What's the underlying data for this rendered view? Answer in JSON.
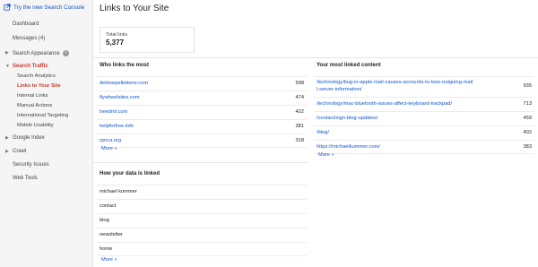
{
  "sidebar": {
    "try_new": "Try the new Search Console",
    "items": {
      "dashboard": "Dashboard",
      "messages": "Messages (4)",
      "search_appearance": "Search Appearance",
      "search_traffic": "Search Traffic",
      "search_analytics": "Search Analytics",
      "links_to_your_site": "Links to Your Site",
      "internal_links": "Internal Links",
      "manual_actions": "Manual Actions",
      "international_targeting": "International Targeting",
      "mobile_usability": "Mobile Usability",
      "google_index": "Google Index",
      "crawl": "Crawl",
      "security_issues": "Security Issues",
      "web_tools": "Web Tools"
    },
    "info_badge": "i"
  },
  "main": {
    "title": "Links to Your Site",
    "total": {
      "label": "Total links",
      "value": "5,377"
    },
    "who_links": {
      "title": "Who links the most",
      "rows": [
        {
          "domain": "delmarpelletierie.com",
          "count": "598"
        },
        {
          "domain": "flywheelsites.com",
          "count": "474"
        },
        {
          "domain": "treedml.com",
          "count": "422"
        },
        {
          "domain": "helpforfree.info",
          "count": "381"
        },
        {
          "domain": "rpnca.org",
          "count": "318"
        }
      ],
      "more": "More »"
    },
    "most_linked": {
      "title": "Your most linked content",
      "rows": [
        {
          "url": "/technology/bug-in-apple-mail-causes-accounts-to-lose-outgoing-mail",
          "url2": "l-server-information/",
          "count": "935"
        },
        {
          "url": "/technology/mac-bluetooth-issues-affect-keyboard-trackpad/",
          "url2": "",
          "count": "713"
        },
        {
          "url": "/contact/sign-blog-updates/",
          "url2": "",
          "count": "459"
        },
        {
          "url": "/blog/",
          "url2": "",
          "count": "402"
        },
        {
          "url": "https://michaelkummer.com/",
          "url2": "",
          "count": "383"
        }
      ],
      "more": "More »"
    },
    "how_linked": {
      "title": "How your data is linked",
      "rows": [
        "michael kummer",
        "contact",
        "blog",
        "newsletter",
        "home"
      ],
      "more": "More »"
    }
  }
}
